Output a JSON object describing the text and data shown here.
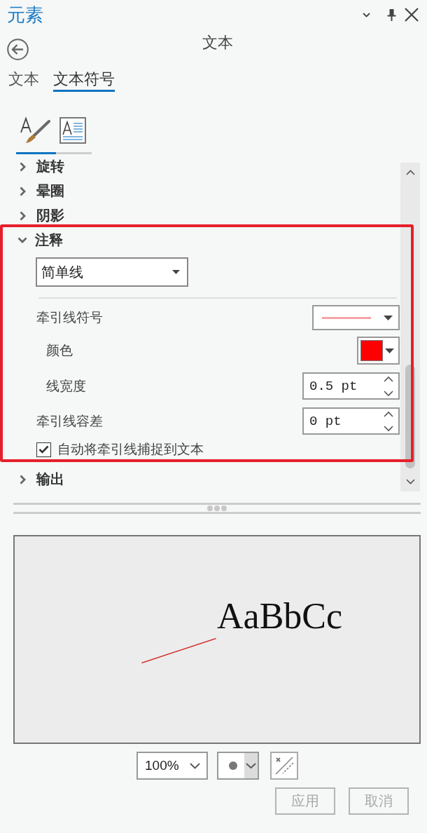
{
  "panel": {
    "title": "元素"
  },
  "pane": {
    "title": "文本"
  },
  "tabs": [
    {
      "label": "文本",
      "selected": false
    },
    {
      "label": "文本符号",
      "selected": true
    }
  ],
  "symbol_tabs": [
    {
      "kind": "text-paint",
      "selected": true
    },
    {
      "kind": "text-layout",
      "selected": false
    }
  ],
  "sections": [
    {
      "label": "旋转",
      "expanded": false,
      "highlighted": false
    },
    {
      "label": "晕圈",
      "expanded": false,
      "highlighted": false
    },
    {
      "label": "阴影",
      "expanded": false,
      "highlighted": false
    },
    {
      "label": "注释",
      "expanded": true,
      "highlighted": true,
      "leader": {
        "style": "简单线",
        "rows": [
          {
            "kind": "symbol",
            "label": "牵引线符号",
            "children": [
              {
                "kind": "color",
                "label": "颜色",
                "color": "#ff0000"
              },
              {
                "kind": "spin",
                "label": "线宽度",
                "value": "0.5 pt"
              }
            ]
          },
          {
            "kind": "spin",
            "label": "牵引线容差",
            "value": "0 pt"
          }
        ],
        "snap": {
          "label": "自动将牵引线捕捉到文本",
          "checked": true
        }
      }
    },
    {
      "label": "输出",
      "expanded": false,
      "highlighted": false
    }
  ],
  "preview": {
    "sample_text": "AaBbCc"
  },
  "preview_toolbar": {
    "zoom": "100%"
  },
  "buttons": [
    {
      "label": "应用",
      "disabled": true
    },
    {
      "label": "取消",
      "disabled": true
    }
  ]
}
